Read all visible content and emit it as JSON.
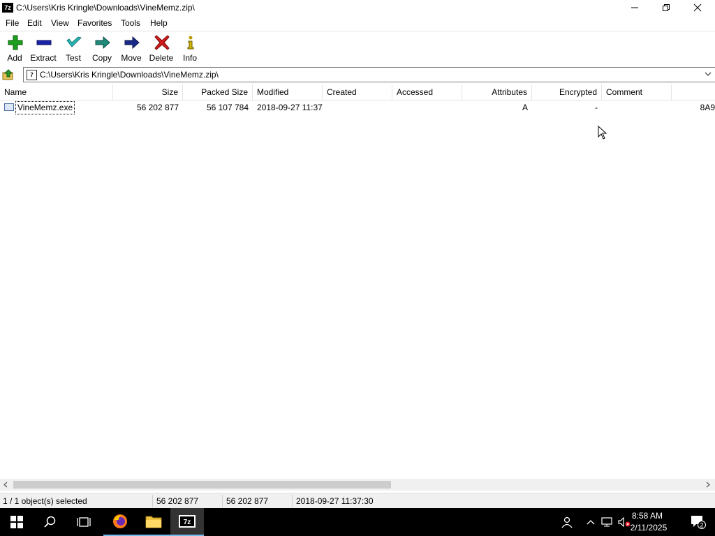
{
  "window": {
    "title": "C:\\Users\\Kris Kringle\\Downloads\\VineMemz.zip\\",
    "app_icon_label": "7z"
  },
  "menu": [
    "File",
    "Edit",
    "View",
    "Favorites",
    "Tools",
    "Help"
  ],
  "toolbar": {
    "add": "Add",
    "extract": "Extract",
    "test": "Test",
    "copy": "Copy",
    "move": "Move",
    "delete": "Delete",
    "info": "Info"
  },
  "address": {
    "path": "C:\\Users\\Kris Kringle\\Downloads\\VineMemz.zip\\"
  },
  "columns": [
    "Name",
    "Size",
    "Packed Size",
    "Modified",
    "Created",
    "Accessed",
    "Attributes",
    "Encrypted",
    "Comment"
  ],
  "files": [
    {
      "name": "VineMemz.exe",
      "size": "56 202 877",
      "packed_size": "56 107 784",
      "modified": "2018-09-27 11:37",
      "created": "",
      "accessed": "",
      "attributes": "A",
      "encrypted": "-",
      "comment": "",
      "extra": "8A9"
    }
  ],
  "status": {
    "selection": "1 / 1 object(s) selected",
    "size": "56 202 877",
    "packed": "56 202 877",
    "modified": "2018-09-27 11:37:30"
  },
  "taskbar": {
    "time": "8:58 AM",
    "date": "2/11/2025",
    "notification_count": "2"
  },
  "colors": {
    "add": "#1e9e1e",
    "extract": "#1a22a8",
    "test": "#2bb5b5",
    "copy": "#1e8a7a",
    "move": "#1a2a8a",
    "delete": "#d21a1a",
    "info": "#b59b00",
    "taskbar_accent": "#76b9ed"
  }
}
